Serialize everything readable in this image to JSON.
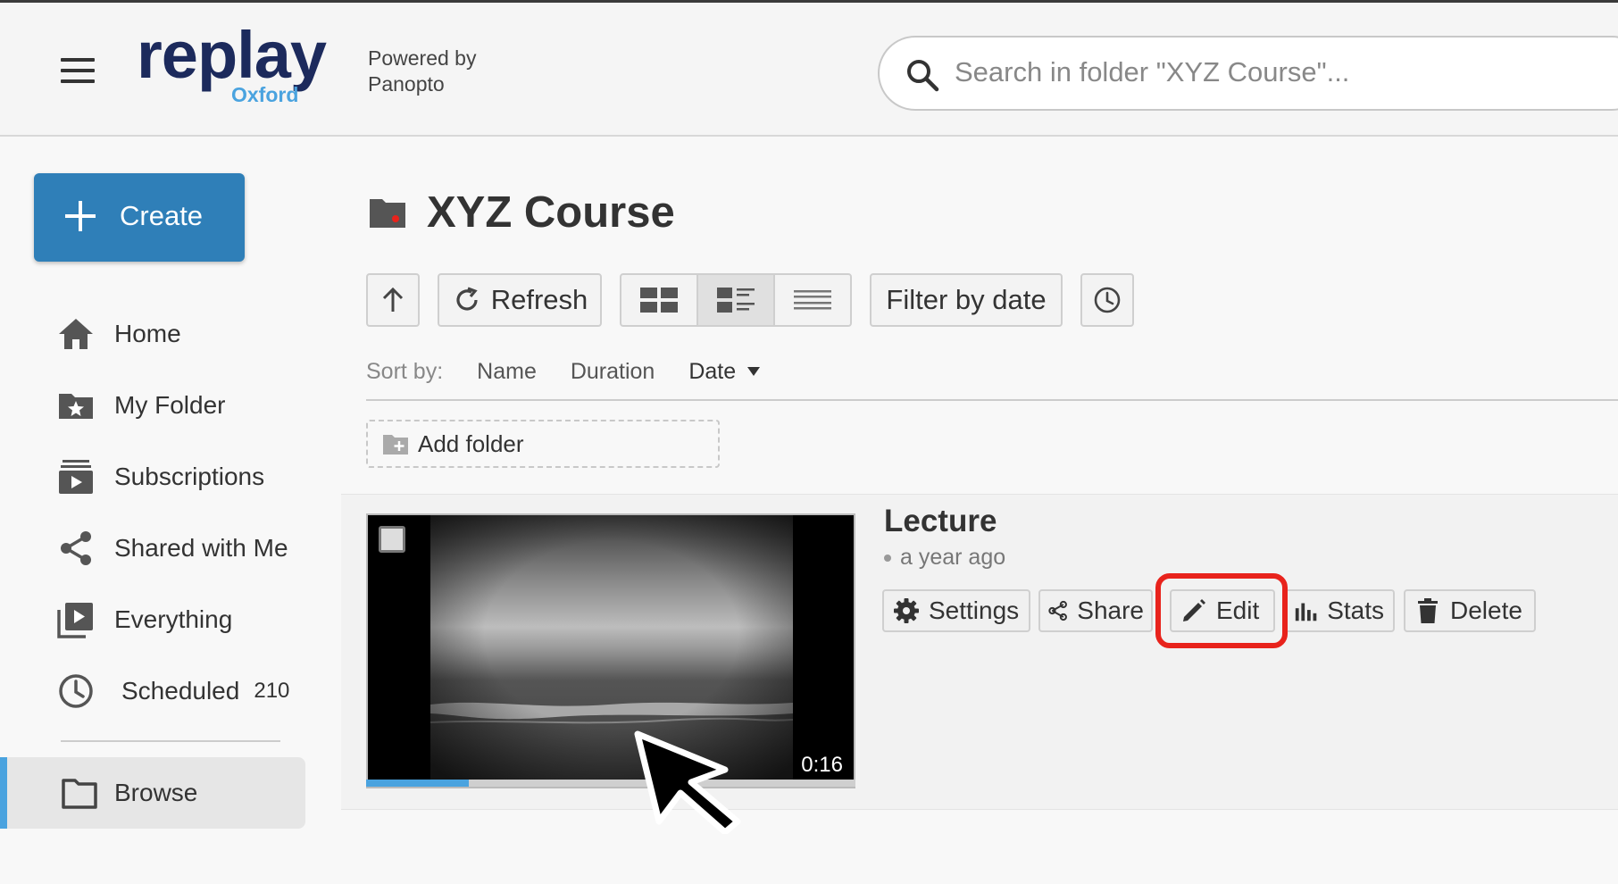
{
  "header": {
    "logo_text": "replay",
    "logo_sub": "Oxford",
    "powered_line1": "Powered by",
    "powered_line2": "Panopto",
    "search_placeholder": "Search in folder \"XYZ Course\"..."
  },
  "sidebar": {
    "create_label": "Create",
    "items": [
      {
        "label": "Home",
        "icon": "home-icon"
      },
      {
        "label": "My Folder",
        "icon": "star-folder-icon"
      },
      {
        "label": "Subscriptions",
        "icon": "subscriptions-icon"
      },
      {
        "label": "Shared with Me",
        "icon": "share-icon"
      },
      {
        "label": "Everything",
        "icon": "play-library-icon"
      },
      {
        "label": "Scheduled",
        "icon": "clock-icon",
        "count": "210"
      }
    ],
    "browse_label": "Browse"
  },
  "folder": {
    "name": "XYZ Course"
  },
  "toolbar": {
    "refresh_label": "Refresh",
    "filter_label": "Filter by date",
    "view_modes": [
      "thumbnail-grid",
      "detail",
      "list"
    ],
    "active_view": "detail"
  },
  "sort": {
    "label": "Sort by:",
    "options": [
      "Name",
      "Duration",
      "Date"
    ],
    "selected": "Date"
  },
  "add_folder_label": "Add folder",
  "session": {
    "title": "Lecture",
    "age": "a year ago",
    "duration": "0:16",
    "progress_fraction": 0.21,
    "actions": [
      "Settings",
      "Share",
      "Edit",
      "Stats",
      "Delete"
    ],
    "highlighted_action": "Edit"
  },
  "colors": {
    "accent": "#2f7fb8",
    "brand_navy": "#1c2a5c",
    "brand_light": "#4aa3df",
    "highlight": "#e8231c"
  }
}
